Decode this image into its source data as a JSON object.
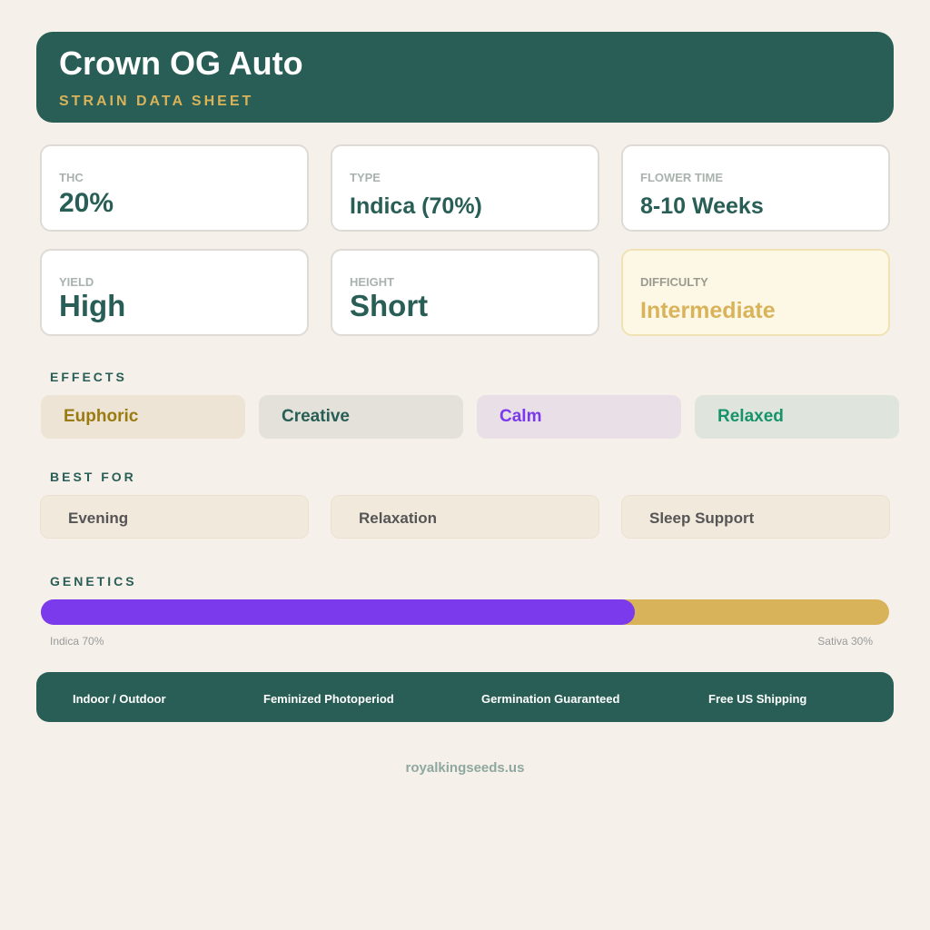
{
  "header": {
    "title": "Crown OG Auto",
    "subtitle": "STRAIN DATA SHEET"
  },
  "stats": [
    {
      "label": "THC",
      "value": "20%"
    },
    {
      "label": "TYPE",
      "value": "Indica (70%)"
    },
    {
      "label": "FLOWER TIME",
      "value": "8-10 Weeks"
    },
    {
      "label": "YIELD",
      "value": "High"
    },
    {
      "label": "HEIGHT",
      "value": "Short"
    },
    {
      "label": "DIFFICULTY",
      "value": "Intermediate"
    }
  ],
  "effects": {
    "heading": "EFFECTS",
    "items": [
      {
        "label": "Euphoric",
        "color": "#9a7b12",
        "bg": "#ede4d5"
      },
      {
        "label": "Creative",
        "color": "#285e55",
        "bg": "#e3e1da"
      },
      {
        "label": "Calm",
        "color": "#7c3aed",
        "bg": "#e9dfe6"
      },
      {
        "label": "Relaxed",
        "color": "#16936a",
        "bg": "#dfe5dd"
      }
    ]
  },
  "best_for": {
    "heading": "BEST FOR",
    "items": [
      "Evening",
      "Relaxation",
      "Sleep Support"
    ]
  },
  "genetics": {
    "heading": "GENETICS",
    "indica_fraction": 0.7,
    "indica_label": "Indica 70%",
    "sativa_label": "Sativa 30%",
    "indica_color": "#7c3aed",
    "sativa_color": "#d9b35a"
  },
  "features": [
    "Indoor / Outdoor",
    "Feminized Photoperiod",
    "Germination Guaranteed",
    "Free US Shipping"
  ],
  "website": "royalkingseeds.us",
  "colors": {
    "brand_green": "#285e55",
    "accent_gold": "#d9b35a",
    "background": "#f5f0ea"
  }
}
